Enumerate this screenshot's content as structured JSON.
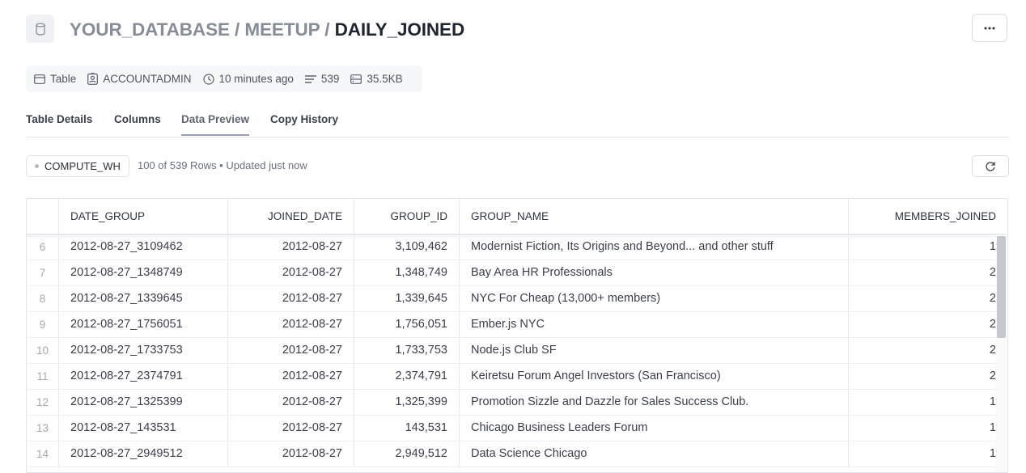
{
  "header": {
    "breadcrumb_db": "YOUR_DATABASE",
    "breadcrumb_schema": "MEETUP",
    "separator": "/",
    "table_name": "DAILY_JOINED",
    "db_icon": "database-icon",
    "more_icon": "more-horizontal-icon"
  },
  "meta": {
    "type_label": "Table",
    "owner": "ACCOUNTADMIN",
    "modified": "10 minutes ago",
    "row_count": "539",
    "size": "35.5KB"
  },
  "tabs": [
    {
      "label": "Table Details",
      "active": false
    },
    {
      "label": "Columns",
      "active": false
    },
    {
      "label": "Data Preview",
      "active": true
    },
    {
      "label": "Copy History",
      "active": false
    }
  ],
  "preview": {
    "warehouse": "COMPUTE_WH",
    "row_info": "100 of 539 Rows • Updated just now",
    "refresh_icon": "refresh-icon"
  },
  "table": {
    "columns": [
      "DATE_GROUP",
      "JOINED_DATE",
      "GROUP_ID",
      "GROUP_NAME",
      "MEMBERS_JOINED"
    ],
    "rows": [
      {
        "idx": "6",
        "date_group": "2012-08-27_3109462",
        "joined_date": "2012-08-27",
        "group_id": "3,109,462",
        "group_name": "Modernist Fiction, Its Origins and Beyond... and other stuff",
        "members_joined": "1"
      },
      {
        "idx": "7",
        "date_group": "2012-08-27_1348749",
        "joined_date": "2012-08-27",
        "group_id": "1,348,749",
        "group_name": "Bay Area HR Professionals",
        "members_joined": "2"
      },
      {
        "idx": "8",
        "date_group": "2012-08-27_1339645",
        "joined_date": "2012-08-27",
        "group_id": "1,339,645",
        "group_name": "NYC For Cheap (13,000+ members)",
        "members_joined": "2"
      },
      {
        "idx": "9",
        "date_group": "2012-08-27_1756051",
        "joined_date": "2012-08-27",
        "group_id": "1,756,051",
        "group_name": "Ember.js NYC",
        "members_joined": "2"
      },
      {
        "idx": "10",
        "date_group": "2012-08-27_1733753",
        "joined_date": "2012-08-27",
        "group_id": "1,733,753",
        "group_name": "Node.js Club SF",
        "members_joined": "2"
      },
      {
        "idx": "11",
        "date_group": "2012-08-27_2374791",
        "joined_date": "2012-08-27",
        "group_id": "2,374,791",
        "group_name": "Keiretsu Forum Angel Investors (San Francisco)",
        "members_joined": "2"
      },
      {
        "idx": "12",
        "date_group": "2012-08-27_1325399",
        "joined_date": "2012-08-27",
        "group_id": "1,325,399",
        "group_name": "Promotion Sizzle and Dazzle for Sales Success Club.",
        "members_joined": "1"
      },
      {
        "idx": "13",
        "date_group": "2012-08-27_143531",
        "joined_date": "2012-08-27",
        "group_id": "143,531",
        "group_name": "Chicago Business Leaders Forum",
        "members_joined": "1"
      },
      {
        "idx": "14",
        "date_group": "2012-08-27_2949512",
        "joined_date": "2012-08-27",
        "group_id": "2,949,512",
        "group_name": "Data Science Chicago",
        "members_joined": "1"
      }
    ]
  }
}
